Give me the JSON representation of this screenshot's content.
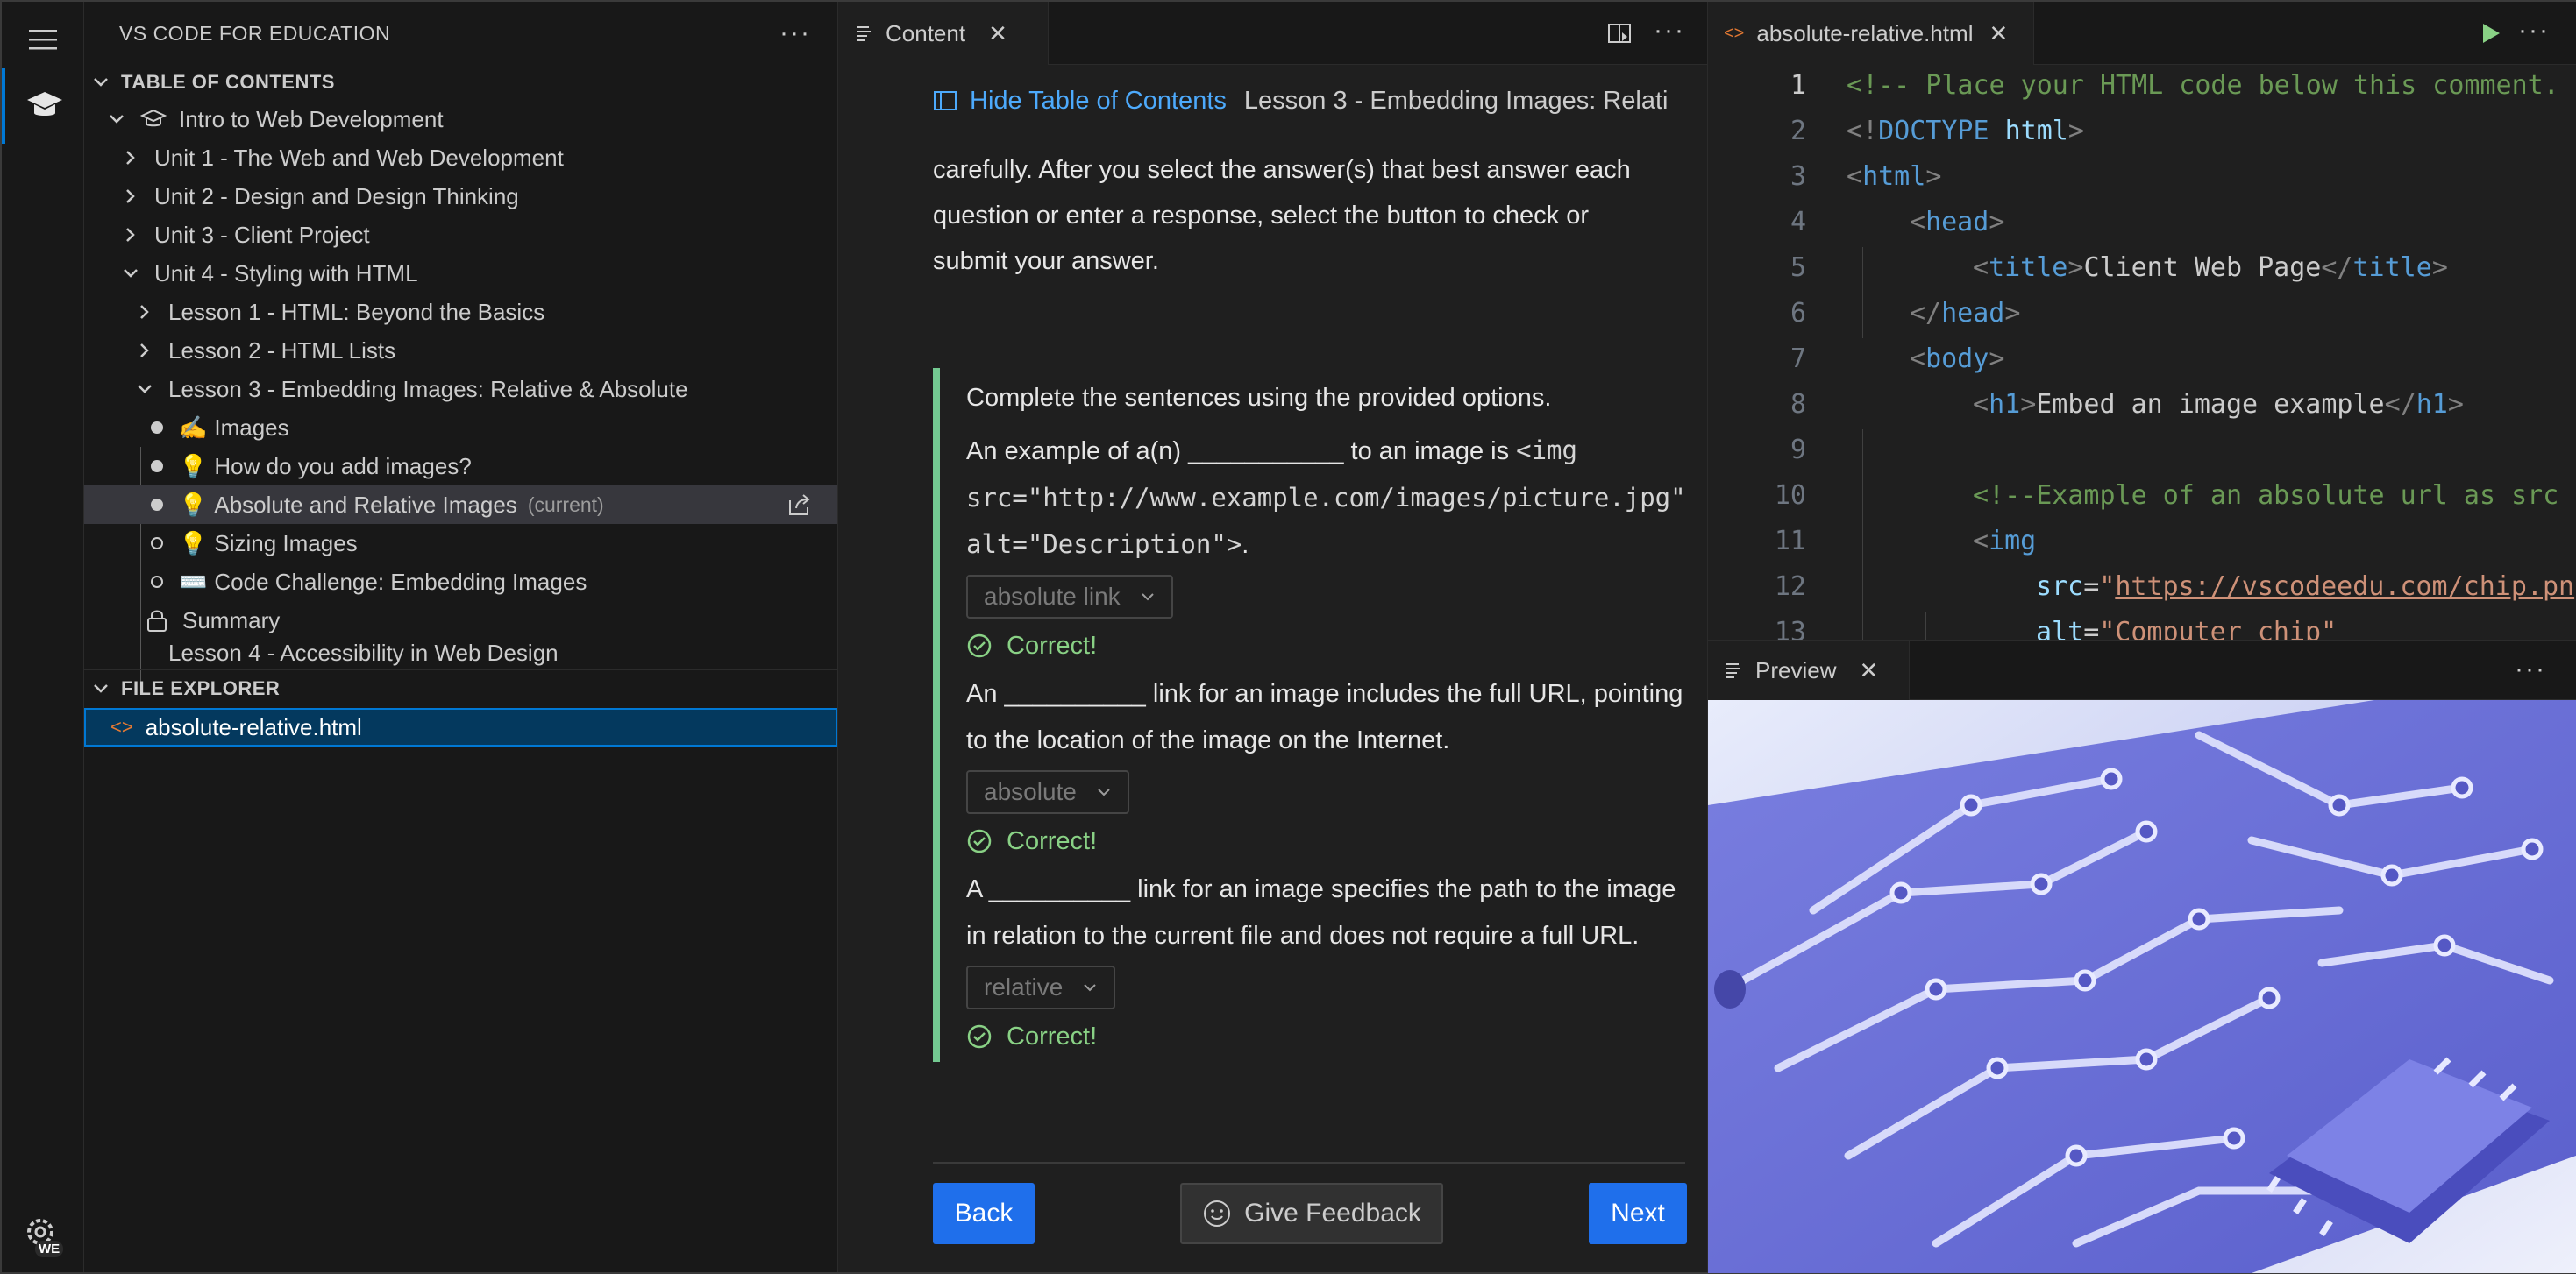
{
  "sidebar": {
    "title": "VS CODE FOR EDUCATION",
    "toc_header": "TABLE OF CONTENTS",
    "course": "Intro to Web Development",
    "units": [
      "Unit 1 - The Web and Web Development",
      "Unit 2 - Design and Design Thinking",
      "Unit 3 - Client Project",
      "Unit 4 - Styling with HTML"
    ],
    "lessons": [
      "Lesson 1 - HTML: Beyond the Basics",
      "Lesson 2 - HTML Lists",
      "Lesson 3 - Embedding Images: Relative & Absolute"
    ],
    "items": [
      {
        "emoji": "✍️",
        "label": "Images"
      },
      {
        "emoji": "💡",
        "label": "How do you add images?"
      },
      {
        "emoji": "💡",
        "label": "Absolute and Relative Images",
        "tag": "(current)"
      },
      {
        "emoji": "💡",
        "label": "Sizing Images"
      },
      {
        "emoji": "⌨️",
        "label": "Code Challenge: Embedding Images"
      },
      {
        "label": "Summary"
      }
    ],
    "next_lesson": "Lesson 4 - Accessibility in Web Design",
    "explorer_header": "FILE EXPLORER",
    "file": "absolute-relative.html"
  },
  "content": {
    "tab": "Content",
    "hide_toc": "Hide Table of Contents",
    "breadcrumb": "Lesson 3 - Embedding Images: Relati",
    "intro": [
      "carefully. After you select the answer(s) that best answer each",
      "question or enter a response, select the button to check or",
      "submit your answer."
    ],
    "quiz_intro": "Complete the sentences using the provided options.",
    "q1": {
      "prefix": "An example of a(n) ___________ to an image is ",
      "code1": "<img",
      "code2": "src=\"http://www.example.com/images/picture.jpg\"",
      "code3": "alt=\"Description\">",
      "suffix": ".",
      "answer": "absolute link",
      "result": "Correct!"
    },
    "q2": {
      "line1": "An __________ link for an image includes the full URL, pointing",
      "line2": "to the location of the image on the Internet.",
      "answer": "absolute",
      "result": "Correct!"
    },
    "q3": {
      "line1": "A __________ link for an image specifies the path to the image",
      "line2": "in relation to the current file and does not require a full URL.",
      "answer": "relative",
      "result": "Correct!"
    },
    "back": "Back",
    "feedback": "Give Feedback",
    "next": "Next"
  },
  "editor": {
    "tab": "absolute-relative.html",
    "line_numbers": [
      "1",
      "2",
      "3",
      "4",
      "5",
      "6",
      "7",
      "8",
      "9",
      "10",
      "11",
      "12",
      "13"
    ],
    "lines": [
      "<!-- Place your HTML code below this comment.",
      "<!DOCTYPE html>",
      "<html>",
      "<head>",
      "<title>Client Web Page</title>",
      "</head>",
      "<body>",
      "<h1>Embed an image example</h1>",
      "",
      "<!--Example of an absolute url as src",
      "<img",
      "src=\"https://vscodeedu.com/chip.pn",
      "alt=\"Computer chip\""
    ]
  },
  "preview": {
    "tab": "Preview",
    "image_alt": "Computer chip"
  },
  "colors": {
    "accent": "#0078d4",
    "correct": "#89d185",
    "button": "#1f6feb",
    "link": "#4daafc"
  },
  "activity": {
    "badge": "WE"
  }
}
